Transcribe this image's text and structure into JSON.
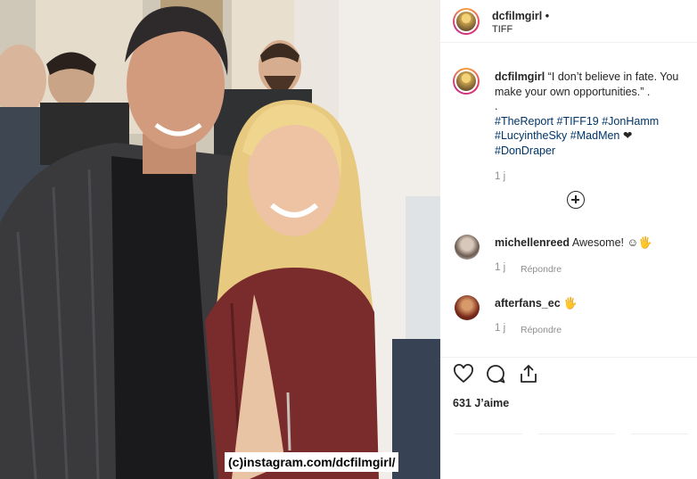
{
  "post": {
    "username": "dcfilmgirl",
    "header_dot": "•",
    "location": "TIFF",
    "watermark": "(c)instagram.com/dcfilmgirl/"
  },
  "caption": {
    "username": "dcfilmgirl",
    "text": "“I don’t believe in fate. You make your own opportunities.” .",
    "dot_line": ".",
    "hashtags": [
      "#TheReport",
      "#TIFF19",
      "#JonHamm",
      "#LucyintheSky",
      "#MadMen",
      "#DonDraper"
    ],
    "heart": "❤",
    "time": "1 j"
  },
  "load_more": {
    "icon": "plus-circle-icon"
  },
  "comments": [
    {
      "username": "michellenreed",
      "text": "Awesome! ☺🖐",
      "time": "1 j",
      "reply_label": "Répondre"
    },
    {
      "username": "afterfans_ec",
      "text": "🖐",
      "time": "1 j",
      "reply_label": "Répondre"
    }
  ],
  "actions": {
    "icons": [
      "heart-icon",
      "comment-icon",
      "share-icon"
    ]
  },
  "likes_label": "631 J’aime",
  "colors": {
    "hashtag": "#003569",
    "muted": "#8e8e8e",
    "text": "#262626",
    "divider": "#efefef"
  }
}
